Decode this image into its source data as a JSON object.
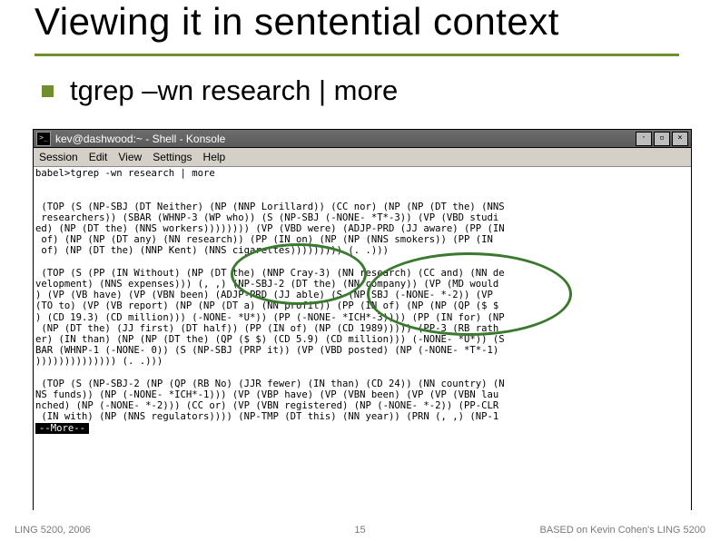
{
  "slide": {
    "title": "Viewing it in sentential context",
    "bullet_text": "tgrep –wn research | more"
  },
  "terminal": {
    "window_title": "kev@dashwood:~ - Shell - Konsole",
    "menus": [
      "Session",
      "Edit",
      "View",
      "Settings",
      "Help"
    ],
    "icon_symbol": ">_",
    "win_buttons": {
      "min": "·",
      "max": "▫",
      "close": "×"
    },
    "lines": [
      "babel>tgrep -wn research | more",
      "",
      "",
      " (TOP (S (NP-SBJ (DT Neither) (NP (NNP Lorillard)) (CC nor) (NP (NP (DT the) (NNS",
      " researchers)) (SBAR (WHNP-3 (WP who)) (S (NP-SBJ (-NONE- *T*-3)) (VP (VBD studi",
      "ed) (NP (DT the) (NNS workers)))))))) (VP (VBD were) (ADJP-PRD (JJ aware) (PP (IN",
      " of) (NP (NP (DT any) (NN research)) (PP (IN on) (NP (NP (NNS smokers)) (PP (IN",
      " of) (NP (DT the) (NNP Kent) (NNS cigarettes))))))))) (. .)))",
      "",
      " (TOP (S (PP (IN Without) (NP (DT the) (NNP Cray-3) (NN research) (CC and) (NN de",
      "velopment) (NNS expenses))) (, ,) (NP-SBJ-2 (DT the) (NN company)) (VP (MD would",
      ") (VP (VB have) (VP (VBN been) (ADJP-PRD (JJ able) (S (NP-SBJ (-NONE- *-2)) (VP",
      "(TO to) (VP (VB report) (NP (NP (DT a) (NN profit)) (PP (IN of) (NP (NP (QP ($ $",
      ") (CD 19.3) (CD million))) (-NONE- *U*)) (PP (-NONE- *ICH*-3)))) (PP (IN for) (NP",
      " (NP (DT the) (JJ first) (DT half)) (PP (IN of) (NP (CD 1989))))) (PP-3 (RB rath",
      "er) (IN than) (NP (NP (DT the) (QP ($ $) (CD 5.9) (CD million))) (-NONE- *U*)) (S",
      "BAR (WHNP-1 (-NONE- 0)) (S (NP-SBJ (PRP it)) (VP (VBD posted) (NP (-NONE- *T*-1)",
      ")))))))))))))) (. .)))",
      "",
      " (TOP (S (NP-SBJ-2 (NP (QP (RB No) (JJR fewer) (IN than) (CD 24)) (NN country) (N",
      "NS funds)) (NP (-NONE- *ICH*-1))) (VP (VBP have) (VP (VBN been) (VP (VP (VBN lau",
      "nched) (NP (-NONE- *-2))) (CC or) (VP (VBN registered) (NP (-NONE- *-2)) (PP-CLR",
      " (IN with) (NP (NNS regulators)))) (NP-TMP (DT this) (NN year)) (PRN (, ,) (NP-1"
    ],
    "more_label": "--More--"
  },
  "footer": {
    "left": "LING 5200, 2006",
    "center": "15",
    "right": "BASED on Kevin Cohen's LING 5200"
  }
}
